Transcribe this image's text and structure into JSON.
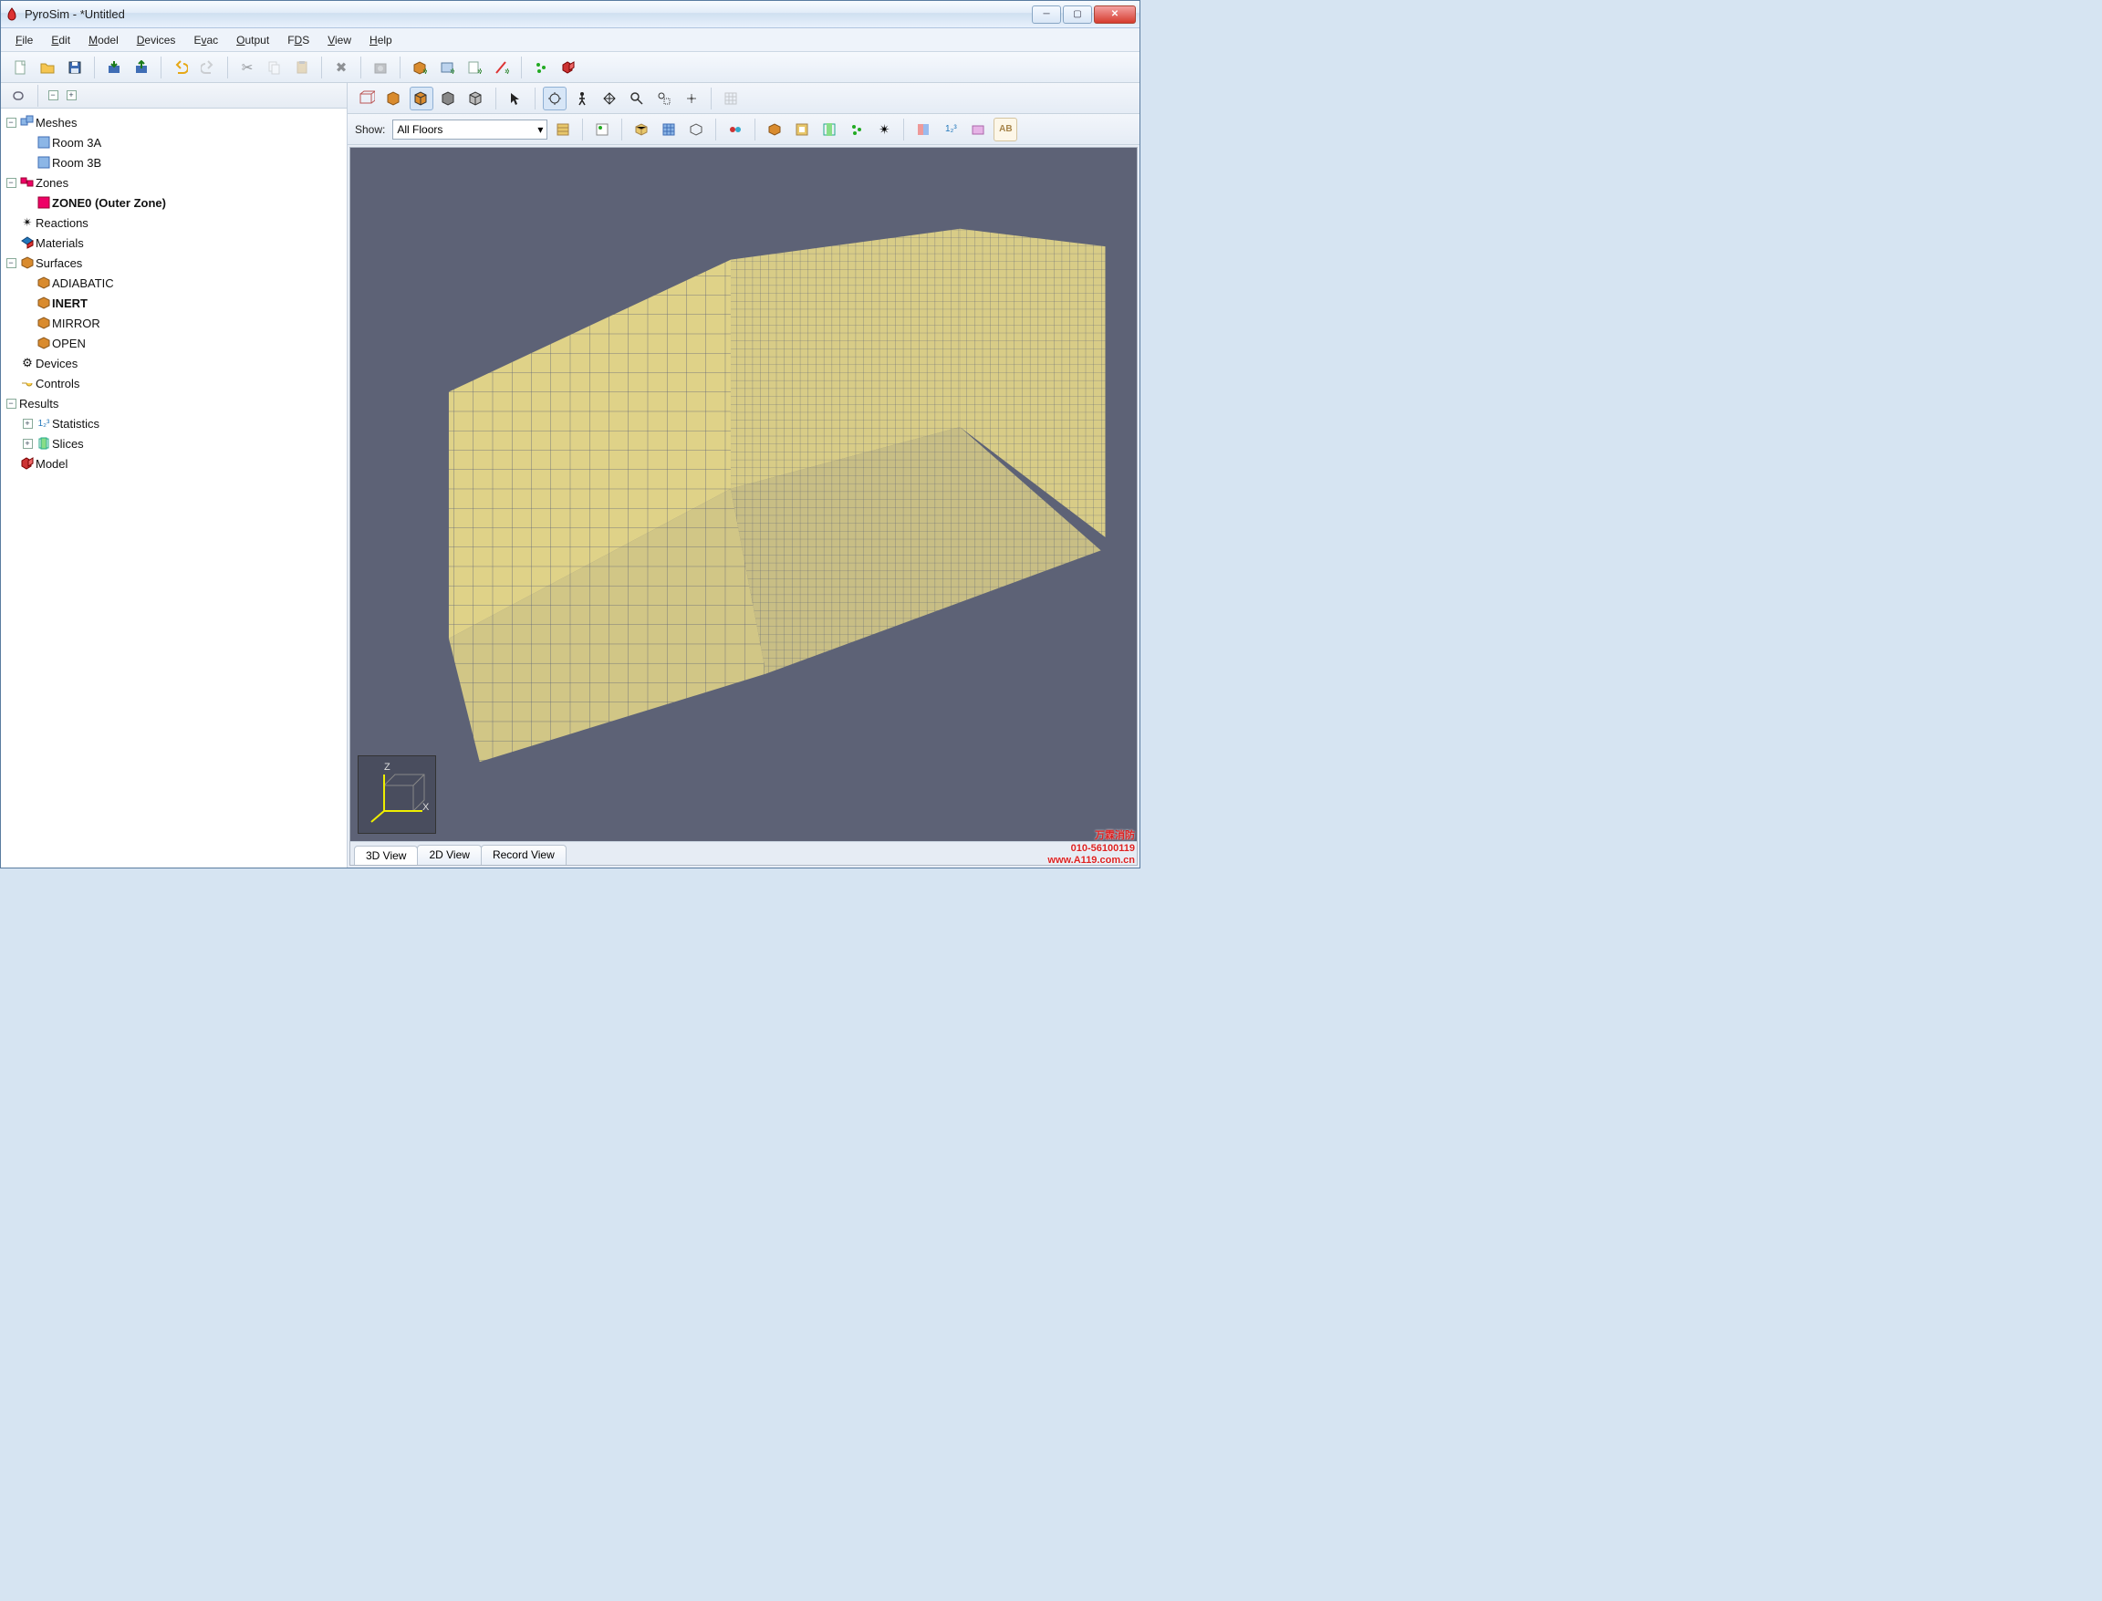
{
  "titlebar": {
    "app": "PyroSim",
    "doc": "*Untitled"
  },
  "menu": {
    "file": "File",
    "edit": "Edit",
    "model": "Model",
    "devices": "Devices",
    "evac": "Evac",
    "output": "Output",
    "fds": "FDS",
    "view": "View",
    "help": "Help"
  },
  "tree": {
    "meshes": "Meshes",
    "room3a": "Room 3A",
    "room3b": "Room 3B",
    "zones": "Zones",
    "zone0": "ZONE0 (Outer Zone)",
    "reactions": "Reactions",
    "materials": "Materials",
    "surfaces": "Surfaces",
    "adiabatic": "ADIABATIC",
    "inert": "INERT",
    "mirror": "MIRROR",
    "open": "OPEN",
    "devices": "Devices",
    "controls": "Controls",
    "results": "Results",
    "statistics": "Statistics",
    "slices": "Slices",
    "model": "Model"
  },
  "viewport": {
    "show_label": "Show:",
    "floor_selector": "All Floors",
    "tab_3d": "3D View",
    "tab_2d": "2D View",
    "tab_record": "Record View",
    "axis_x": "X",
    "axis_z": "Z"
  },
  "watermark": {
    "l1": "万霖消防",
    "l2": "010-56100119",
    "l3": "www.A119.com.cn"
  }
}
